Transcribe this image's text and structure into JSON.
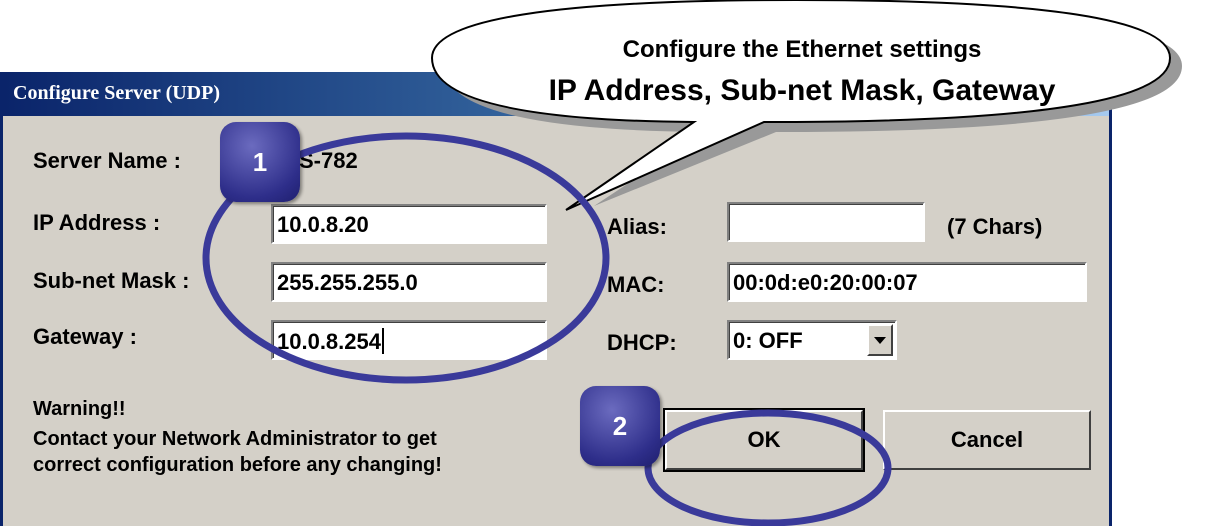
{
  "dialog": {
    "title": "Configure Server (UDP)",
    "server_name_label": "Server Name :",
    "server_name_value": "S-782",
    "ip_label": "IP Address :",
    "ip_value": "10.0.8.20",
    "mask_label": "Sub-net Mask :",
    "mask_value": "255.255.255.0",
    "gateway_label": "Gateway :",
    "gateway_value": "10.0.8.254",
    "alias_label": "Alias:",
    "alias_value": "",
    "alias_hint": "(7 Chars)",
    "mac_label": "MAC:",
    "mac_value": "00:0d:e0:20:00:07",
    "dhcp_label": "DHCP:",
    "dhcp_value": "0: OFF",
    "warning_title": "Warning!!",
    "warning_line1": "Contact your Network Administrator to get",
    "warning_line2": "correct  configuration before any changing!",
    "ok_label": "OK",
    "cancel_label": "Cancel"
  },
  "annotations": {
    "callout_line1": "Configure the Ethernet settings",
    "callout_line2": "IP Address, Sub-net Mask, Gateway",
    "badge_1": "1",
    "badge_2": "2"
  },
  "colors": {
    "titlebar": "#0a246a",
    "dialog_bg": "#d4d0c8",
    "annotation_ring": "#3a3a9a"
  },
  "icons": {
    "dropdown": "chevron-down-icon"
  }
}
